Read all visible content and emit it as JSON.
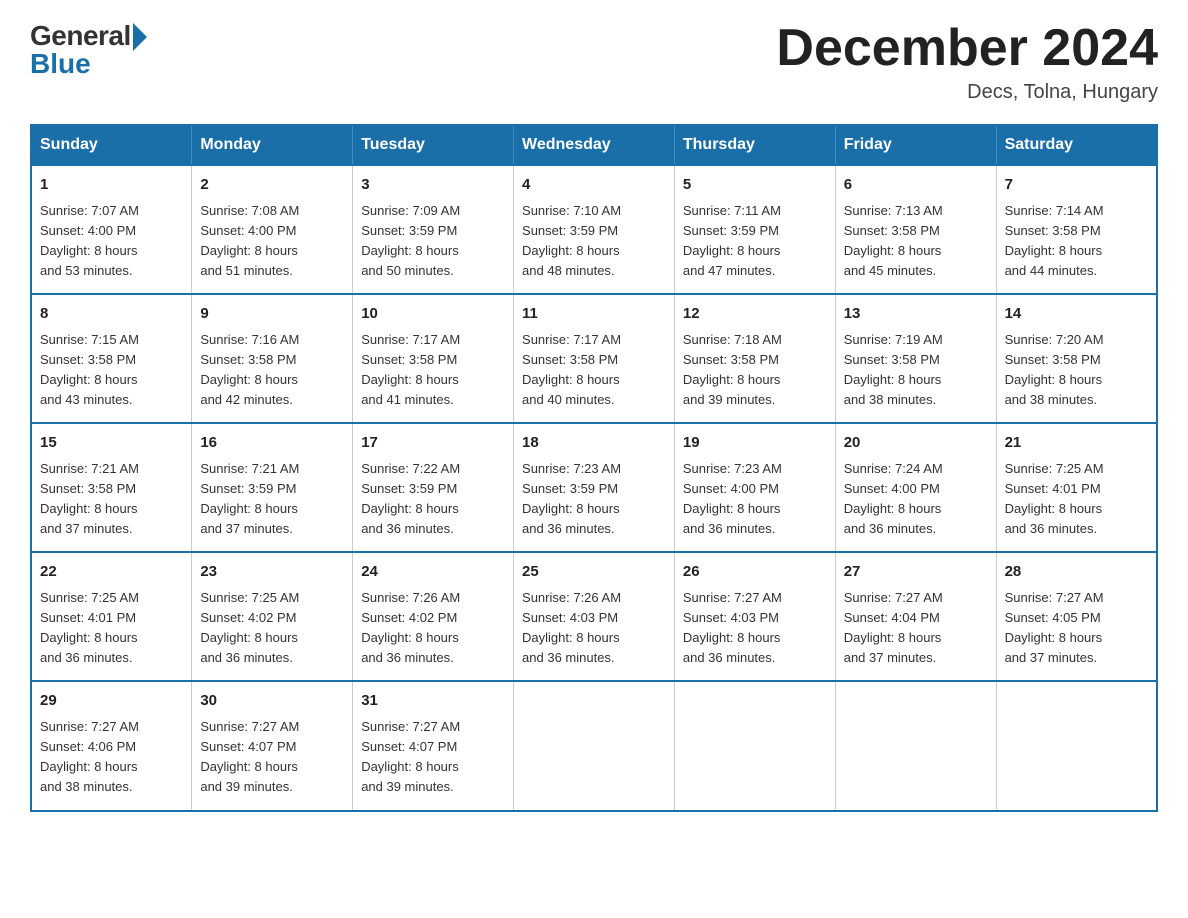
{
  "logo": {
    "general": "General",
    "blue": "Blue"
  },
  "header": {
    "month_title": "December 2024",
    "location": "Decs, Tolna, Hungary"
  },
  "weekdays": [
    "Sunday",
    "Monday",
    "Tuesday",
    "Wednesday",
    "Thursday",
    "Friday",
    "Saturday"
  ],
  "weeks": [
    [
      {
        "day": "1",
        "sunrise": "7:07 AM",
        "sunset": "4:00 PM",
        "daylight": "8 hours and 53 minutes."
      },
      {
        "day": "2",
        "sunrise": "7:08 AM",
        "sunset": "4:00 PM",
        "daylight": "8 hours and 51 minutes."
      },
      {
        "day": "3",
        "sunrise": "7:09 AM",
        "sunset": "3:59 PM",
        "daylight": "8 hours and 50 minutes."
      },
      {
        "day": "4",
        "sunrise": "7:10 AM",
        "sunset": "3:59 PM",
        "daylight": "8 hours and 48 minutes."
      },
      {
        "day": "5",
        "sunrise": "7:11 AM",
        "sunset": "3:59 PM",
        "daylight": "8 hours and 47 minutes."
      },
      {
        "day": "6",
        "sunrise": "7:13 AM",
        "sunset": "3:58 PM",
        "daylight": "8 hours and 45 minutes."
      },
      {
        "day": "7",
        "sunrise": "7:14 AM",
        "sunset": "3:58 PM",
        "daylight": "8 hours and 44 minutes."
      }
    ],
    [
      {
        "day": "8",
        "sunrise": "7:15 AM",
        "sunset": "3:58 PM",
        "daylight": "8 hours and 43 minutes."
      },
      {
        "day": "9",
        "sunrise": "7:16 AM",
        "sunset": "3:58 PM",
        "daylight": "8 hours and 42 minutes."
      },
      {
        "day": "10",
        "sunrise": "7:17 AM",
        "sunset": "3:58 PM",
        "daylight": "8 hours and 41 minutes."
      },
      {
        "day": "11",
        "sunrise": "7:17 AM",
        "sunset": "3:58 PM",
        "daylight": "8 hours and 40 minutes."
      },
      {
        "day": "12",
        "sunrise": "7:18 AM",
        "sunset": "3:58 PM",
        "daylight": "8 hours and 39 minutes."
      },
      {
        "day": "13",
        "sunrise": "7:19 AM",
        "sunset": "3:58 PM",
        "daylight": "8 hours and 38 minutes."
      },
      {
        "day": "14",
        "sunrise": "7:20 AM",
        "sunset": "3:58 PM",
        "daylight": "8 hours and 38 minutes."
      }
    ],
    [
      {
        "day": "15",
        "sunrise": "7:21 AM",
        "sunset": "3:58 PM",
        "daylight": "8 hours and 37 minutes."
      },
      {
        "day": "16",
        "sunrise": "7:21 AM",
        "sunset": "3:59 PM",
        "daylight": "8 hours and 37 minutes."
      },
      {
        "day": "17",
        "sunrise": "7:22 AM",
        "sunset": "3:59 PM",
        "daylight": "8 hours and 36 minutes."
      },
      {
        "day": "18",
        "sunrise": "7:23 AM",
        "sunset": "3:59 PM",
        "daylight": "8 hours and 36 minutes."
      },
      {
        "day": "19",
        "sunrise": "7:23 AM",
        "sunset": "4:00 PM",
        "daylight": "8 hours and 36 minutes."
      },
      {
        "day": "20",
        "sunrise": "7:24 AM",
        "sunset": "4:00 PM",
        "daylight": "8 hours and 36 minutes."
      },
      {
        "day": "21",
        "sunrise": "7:25 AM",
        "sunset": "4:01 PM",
        "daylight": "8 hours and 36 minutes."
      }
    ],
    [
      {
        "day": "22",
        "sunrise": "7:25 AM",
        "sunset": "4:01 PM",
        "daylight": "8 hours and 36 minutes."
      },
      {
        "day": "23",
        "sunrise": "7:25 AM",
        "sunset": "4:02 PM",
        "daylight": "8 hours and 36 minutes."
      },
      {
        "day": "24",
        "sunrise": "7:26 AM",
        "sunset": "4:02 PM",
        "daylight": "8 hours and 36 minutes."
      },
      {
        "day": "25",
        "sunrise": "7:26 AM",
        "sunset": "4:03 PM",
        "daylight": "8 hours and 36 minutes."
      },
      {
        "day": "26",
        "sunrise": "7:27 AM",
        "sunset": "4:03 PM",
        "daylight": "8 hours and 36 minutes."
      },
      {
        "day": "27",
        "sunrise": "7:27 AM",
        "sunset": "4:04 PM",
        "daylight": "8 hours and 37 minutes."
      },
      {
        "day": "28",
        "sunrise": "7:27 AM",
        "sunset": "4:05 PM",
        "daylight": "8 hours and 37 minutes."
      }
    ],
    [
      {
        "day": "29",
        "sunrise": "7:27 AM",
        "sunset": "4:06 PM",
        "daylight": "8 hours and 38 minutes."
      },
      {
        "day": "30",
        "sunrise": "7:27 AM",
        "sunset": "4:07 PM",
        "daylight": "8 hours and 39 minutes."
      },
      {
        "day": "31",
        "sunrise": "7:27 AM",
        "sunset": "4:07 PM",
        "daylight": "8 hours and 39 minutes."
      },
      null,
      null,
      null,
      null
    ]
  ],
  "labels": {
    "sunrise": "Sunrise:",
    "sunset": "Sunset:",
    "daylight": "Daylight:"
  }
}
